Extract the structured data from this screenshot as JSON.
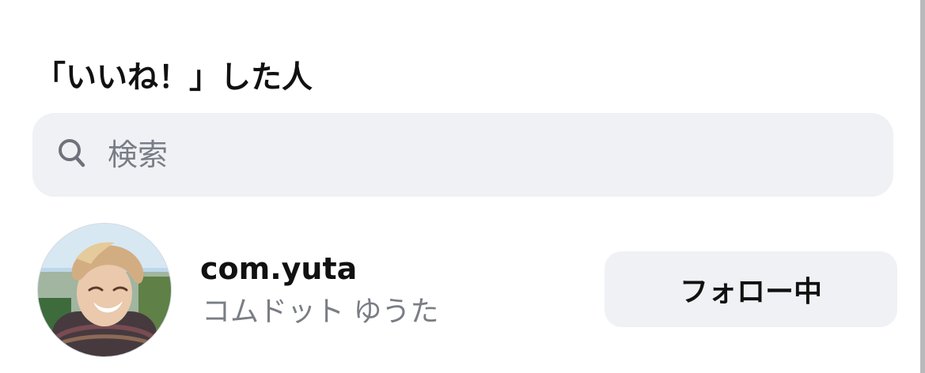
{
  "header": {
    "title": "「いいね！」した人"
  },
  "search": {
    "placeholder": "検索",
    "value": "",
    "icon": "search-icon"
  },
  "users": [
    {
      "username": "com.yuta",
      "display_name": "コムドット ゆうた",
      "follow_label": "フォロー中",
      "avatar_icon": "user-avatar"
    }
  ],
  "colors": {
    "search_background": "#eff1f5",
    "button_background": "#eff1f5",
    "secondary_text": "#7a7d85",
    "primary_text": "#111111"
  }
}
